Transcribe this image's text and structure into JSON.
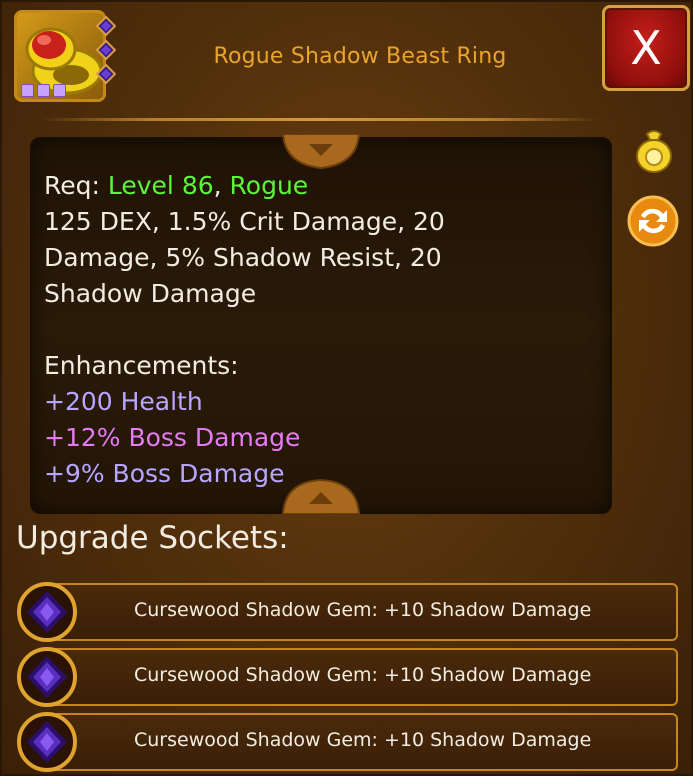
{
  "item": {
    "title": "Rogue Shadow Beast Ring",
    "icon": "gold-ring-with-red-gem-icon",
    "rarity_dots": 3,
    "slot_gems": 3
  },
  "buttons": {
    "close_label": "X",
    "coin_bag_icon": "coin-bag-icon",
    "swap_icon": "swap-arrows-icon"
  },
  "description": {
    "req_prefix": "Req: ",
    "req_level": "Level 86",
    "req_sep": ", ",
    "req_class": "Rogue",
    "stats_line1": "125 DEX, 1.5% Crit Damage, 20",
    "stats_line2": "Damage, 5% Shadow Resist, 20",
    "stats_line3": "Shadow Damage",
    "enhancements_heading": "Enhancements:",
    "enhancements": [
      "+200 Health",
      "+12% Boss Damage",
      "+9% Boss Damage"
    ]
  },
  "sockets": {
    "heading": "Upgrade Sockets:",
    "items": [
      "Cursewood Shadow Gem: +10 Shadow Damage",
      "Cursewood Shadow Gem: +10 Shadow Damage",
      "Cursewood Shadow Gem: +10 Shadow Damage"
    ]
  },
  "colors": {
    "title": "#e9a52a",
    "req_green": "#5cf53a",
    "enh_purple": "#b7a6ff",
    "enh_pink": "#e37cf2",
    "close_red": "#c41f1a",
    "gold_border": "#c5871d"
  }
}
